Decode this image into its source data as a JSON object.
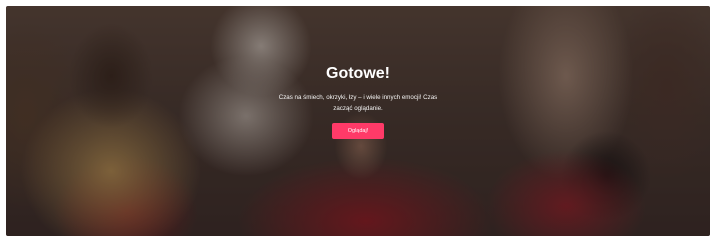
{
  "hero": {
    "title": "Gotowe!",
    "message": "Czas na śmiech, okrzyki, łzy – i wiele innych emocji! Czas zacząć oglądanie.",
    "button_label": "Oglądaj!",
    "accent_color": "#ff3a68"
  }
}
